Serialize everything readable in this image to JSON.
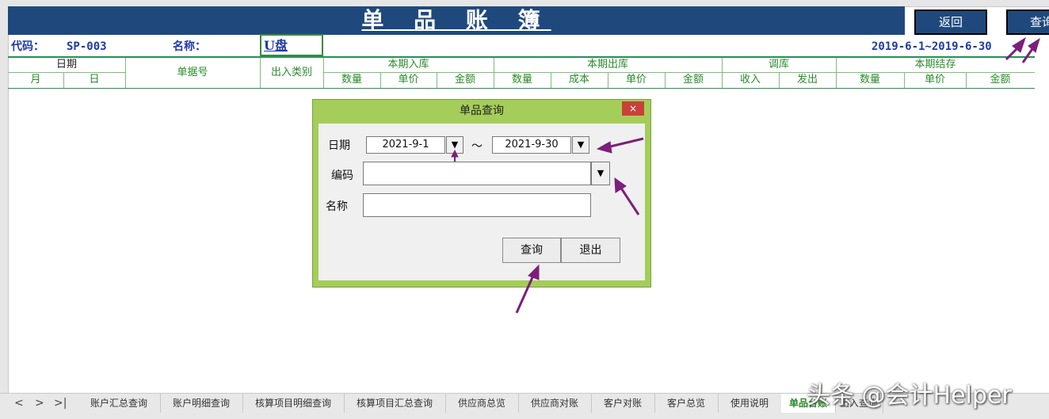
{
  "banner": {
    "title": "单 品 账 簿",
    "back_label": "返回",
    "query_label": "查询"
  },
  "info": {
    "code_label": "代码：",
    "code_value": "SP-003",
    "name_label": "名称：",
    "name_value": "U盘",
    "period": "2019-6-1~2019-6-30"
  },
  "table_header": {
    "date": "日期",
    "month": "月",
    "day": "日",
    "doc_no": "单据号",
    "io_type": "出入类别",
    "in_group": "本期入库",
    "out_group": "本期出库",
    "transfer_group": "调库",
    "balance_group": "本期结存",
    "qty": "数量",
    "price": "单价",
    "amount": "金额",
    "cost": "成本",
    "receive": "收入",
    "send": "发出"
  },
  "dialog": {
    "title": "单品查询",
    "close": "×",
    "date_label": "日期",
    "date_from": "2021-9-1",
    "date_sep": "～",
    "date_to": "2021-9-30",
    "code_label": "编码",
    "code_value": "",
    "name_label": "名称",
    "name_value": "",
    "query_button": "查询",
    "exit_button": "退出",
    "dropdown_glyph": "▼"
  },
  "tabs": [
    "账户汇总查询",
    "账户明细查询",
    "核算项目明细查询",
    "核算项目汇总查询",
    "供应商总览",
    "供应商对账",
    "客户对账",
    "客户总览",
    "使用说明",
    "单品台账",
    "出入查询"
  ],
  "active_tab": "单品台账",
  "watermark": "头条 @会计Helper",
  "colors": {
    "banner": "#1f497d",
    "header_text": "#2a8a2a",
    "dialog_frame": "#a5cd5a",
    "arrow": "#7b1f7b",
    "close": "#c9403a"
  }
}
